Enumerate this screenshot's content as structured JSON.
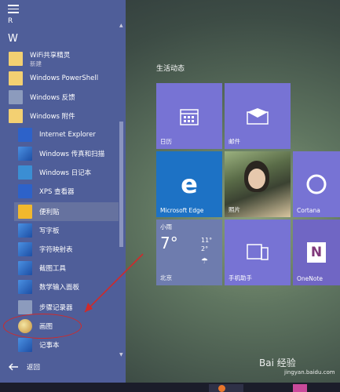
{
  "menu": {
    "section_letter_top": "R",
    "section_letter_w": "W",
    "items": [
      {
        "label": "WiFi共享精灵",
        "sub": "新建"
      },
      {
        "label": "Windows PowerShell"
      },
      {
        "label": "Windows 反馈"
      },
      {
        "label": "Windows 附件"
      },
      {
        "label": "Internet Explorer"
      },
      {
        "label": "Windows 传真和扫描"
      },
      {
        "label": "Windows 日记本"
      },
      {
        "label": "XPS 查看器"
      },
      {
        "label": "便利贴"
      },
      {
        "label": "写字板"
      },
      {
        "label": "字符映射表"
      },
      {
        "label": "截图工具"
      },
      {
        "label": "数学输入面板"
      },
      {
        "label": "步骤记录器"
      },
      {
        "label": "画图"
      },
      {
        "label": "记事本"
      }
    ],
    "back_label": "返回"
  },
  "tiles": {
    "section_title": "生活动态",
    "calendar": "日历",
    "mail": "邮件",
    "edge": "Microsoft Edge",
    "photos": "照片",
    "cortana": "Cortana",
    "weather": {
      "city_top": "小雨",
      "temp": "7°",
      "high": "11°",
      "low": "2°",
      "city": "北京"
    },
    "phone": "手机助手",
    "onenote": "OneNote"
  },
  "watermark": {
    "main": "Bai 经验",
    "sub": "jingyan.baidu.com"
  },
  "colors": {
    "menu_bg": "#4f5e99",
    "tile": "#7773d4",
    "edge_tile": "#1d72c5",
    "annotation": "#d02a2a"
  }
}
